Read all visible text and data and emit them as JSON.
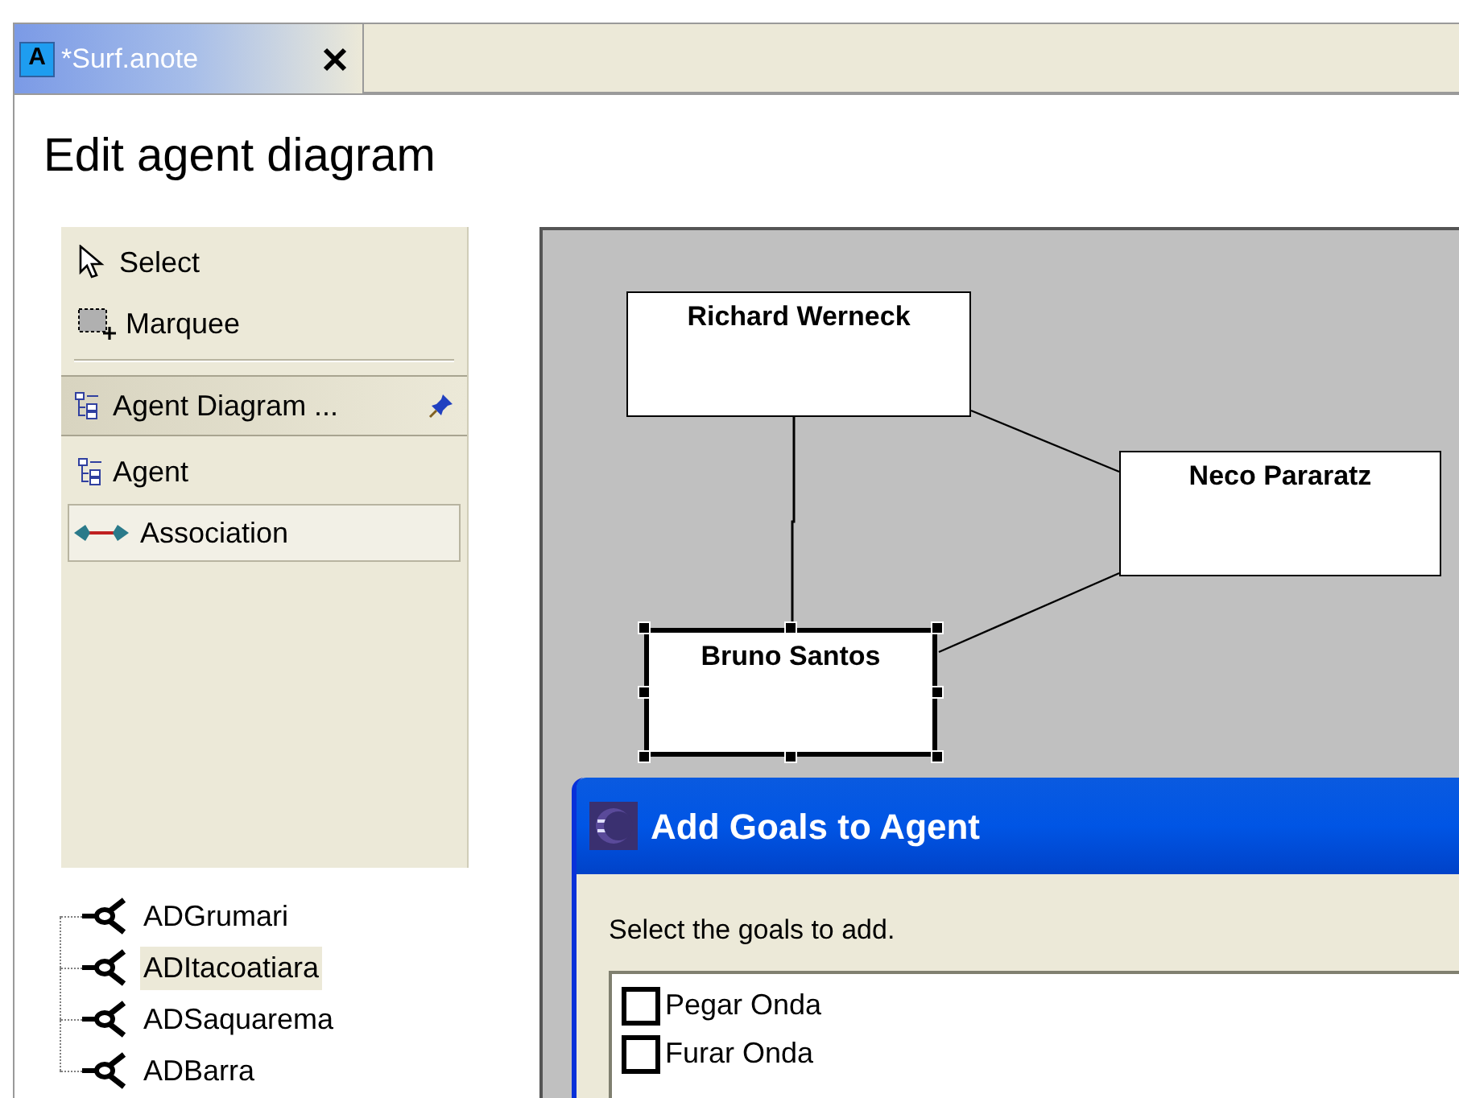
{
  "editor_tab": {
    "icon_letter": "A",
    "title": "*Surf.anote",
    "selected": true
  },
  "page_title": "Edit agent diagram",
  "palette": {
    "tools": [
      {
        "label": "Select",
        "kind": "select"
      },
      {
        "label": "Marquee",
        "kind": "marquee"
      }
    ],
    "drawer": {
      "label": "Agent Diagram ...",
      "expanded": true,
      "items": [
        {
          "label": "Agent",
          "kind": "agent",
          "selected": false
        },
        {
          "label": "Association",
          "kind": "association",
          "selected": true
        }
      ]
    }
  },
  "tree": [
    {
      "label": "ADGrumari",
      "selected": false
    },
    {
      "label": "ADItacoatiara",
      "selected": true
    },
    {
      "label": "ADSaquarema",
      "selected": false
    },
    {
      "label": "ADBarra",
      "selected": false
    }
  ],
  "diagram": {
    "agents": [
      {
        "name": "Richard Werneck",
        "selected": false
      },
      {
        "name": "Neco Pararatz",
        "selected": false
      },
      {
        "name": "Bruno Santos",
        "selected": true
      }
    ]
  },
  "dialog": {
    "title": "Add Goals to Agent",
    "prompt": "Select the goals to add.",
    "goals": [
      {
        "label": "Pegar Onda",
        "checked": false
      },
      {
        "label": "Furar Onda",
        "checked": false
      }
    ]
  }
}
